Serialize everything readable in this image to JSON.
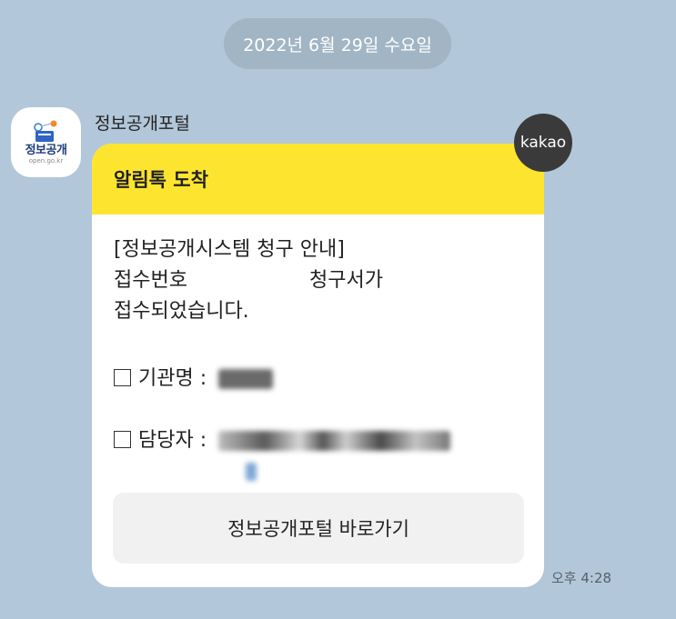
{
  "date_divider": "2022년 6월 29일 수요일",
  "sender": {
    "name": "정보공개포털",
    "avatar_text": "정보공개",
    "avatar_subtext": "open.go.kr"
  },
  "badge": "kakao",
  "message": {
    "header": "알림톡 도착",
    "line1": "[정보공개시스템 청구 안내]",
    "line2_prefix": "접수번호",
    "line2_suffix": "청구서가",
    "line3": "접수되었습니다.",
    "agency_label": "기관명 :",
    "contact_label": "담당자 :",
    "button_label": "정보공개포털 바로가기"
  },
  "timestamp": "오후 4:28",
  "colors": {
    "background": "#b2c7d9",
    "header_yellow": "#fde52f",
    "button_gray": "#f1f1f1",
    "badge_dark": "#3a3a3a"
  }
}
